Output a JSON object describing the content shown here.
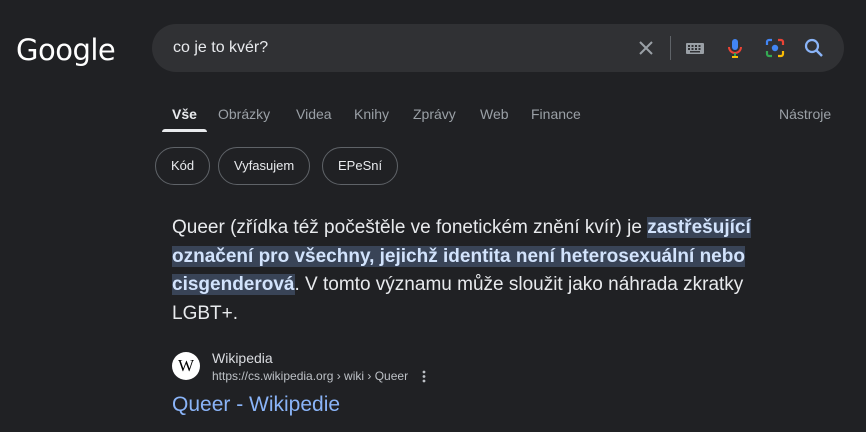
{
  "logo": {
    "text": "Google"
  },
  "search": {
    "query": "co je to kvér?",
    "icons": [
      "close-icon",
      "keyboard-icon",
      "microphone-icon",
      "camera-lens-icon",
      "search-icon"
    ]
  },
  "tabs": [
    {
      "label": "Vše",
      "active": true
    },
    {
      "label": "Obrázky"
    },
    {
      "label": "Videa"
    },
    {
      "label": "Knihy"
    },
    {
      "label": "Zprávy"
    },
    {
      "label": "Web"
    },
    {
      "label": "Finance"
    }
  ],
  "tools_label": "Nástroje",
  "chips": [
    "Kód",
    "Vyfasujem",
    "EPeSní"
  ],
  "snippet": {
    "text_before": "Queer (zřídka též počeštěle ve fonetickém znění kvír) je ",
    "highlight": "zastřešující označení pro všechny, jejichž identita není heterosexuální nebo cisgenderová",
    "text_after": ". V tomto významu může sloužit jako náhrada zkratky LGBT+."
  },
  "result": {
    "favicon_letter": "W",
    "site_name": "Wikipedia",
    "url": "https://cs.wikipedia.org › wiki › Queer",
    "title": "Queer - Wikipedie"
  },
  "colors": {
    "background": "#202124",
    "search_box": "#303134",
    "link": "#8ab4f8",
    "highlight_bg": "#394457",
    "highlight_text": "#d2e3fc"
  }
}
